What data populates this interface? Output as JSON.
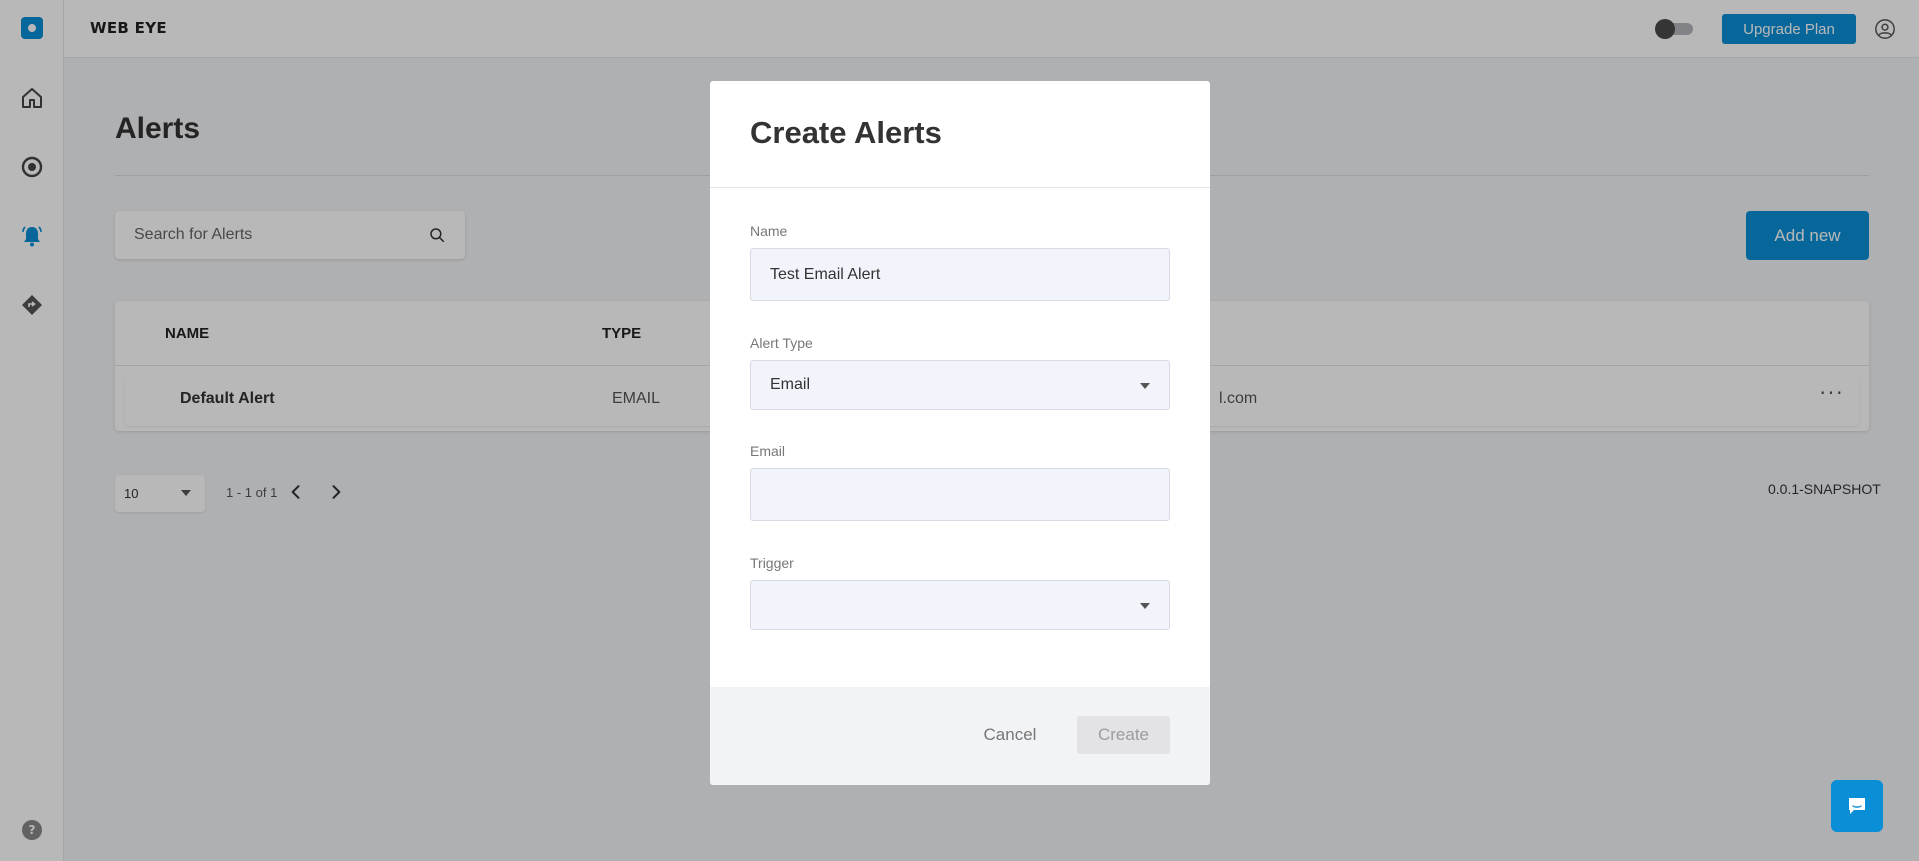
{
  "app": {
    "title": "WEB EYE"
  },
  "topbar": {
    "upgrade_label": "Upgrade Plan"
  },
  "sidebar": {
    "items": [
      {
        "name": "home-icon"
      },
      {
        "name": "target-icon"
      },
      {
        "name": "alerts-icon",
        "active": true
      },
      {
        "name": "route-icon"
      }
    ],
    "help_label": "?"
  },
  "page": {
    "title": "Alerts",
    "search_placeholder": "Search for Alerts",
    "add_new_label": "Add new"
  },
  "table": {
    "columns": {
      "name": "NAME",
      "type": "TYPE"
    },
    "rows": [
      {
        "name": "Default Alert",
        "type": "EMAIL",
        "destination_partial": "l.com",
        "more_label": "···"
      }
    ]
  },
  "pagination": {
    "page_size": "10",
    "range": "1 - 1 of 1"
  },
  "footer": {
    "version": "0.0.1-SNAPSHOT"
  },
  "modal": {
    "title": "Create Alerts",
    "fields": {
      "name": {
        "label": "Name",
        "value": "Test Email Alert"
      },
      "alert_type": {
        "label": "Alert Type",
        "value": "Email"
      },
      "email": {
        "label": "Email",
        "value": ""
      },
      "trigger": {
        "label": "Trigger",
        "value": ""
      }
    },
    "cancel_label": "Cancel",
    "create_label": "Create"
  },
  "colors": {
    "accent": "#0a8fd6",
    "overlay": "rgba(0,0,0,0.28)",
    "input_bg": "#f1f4fb"
  }
}
